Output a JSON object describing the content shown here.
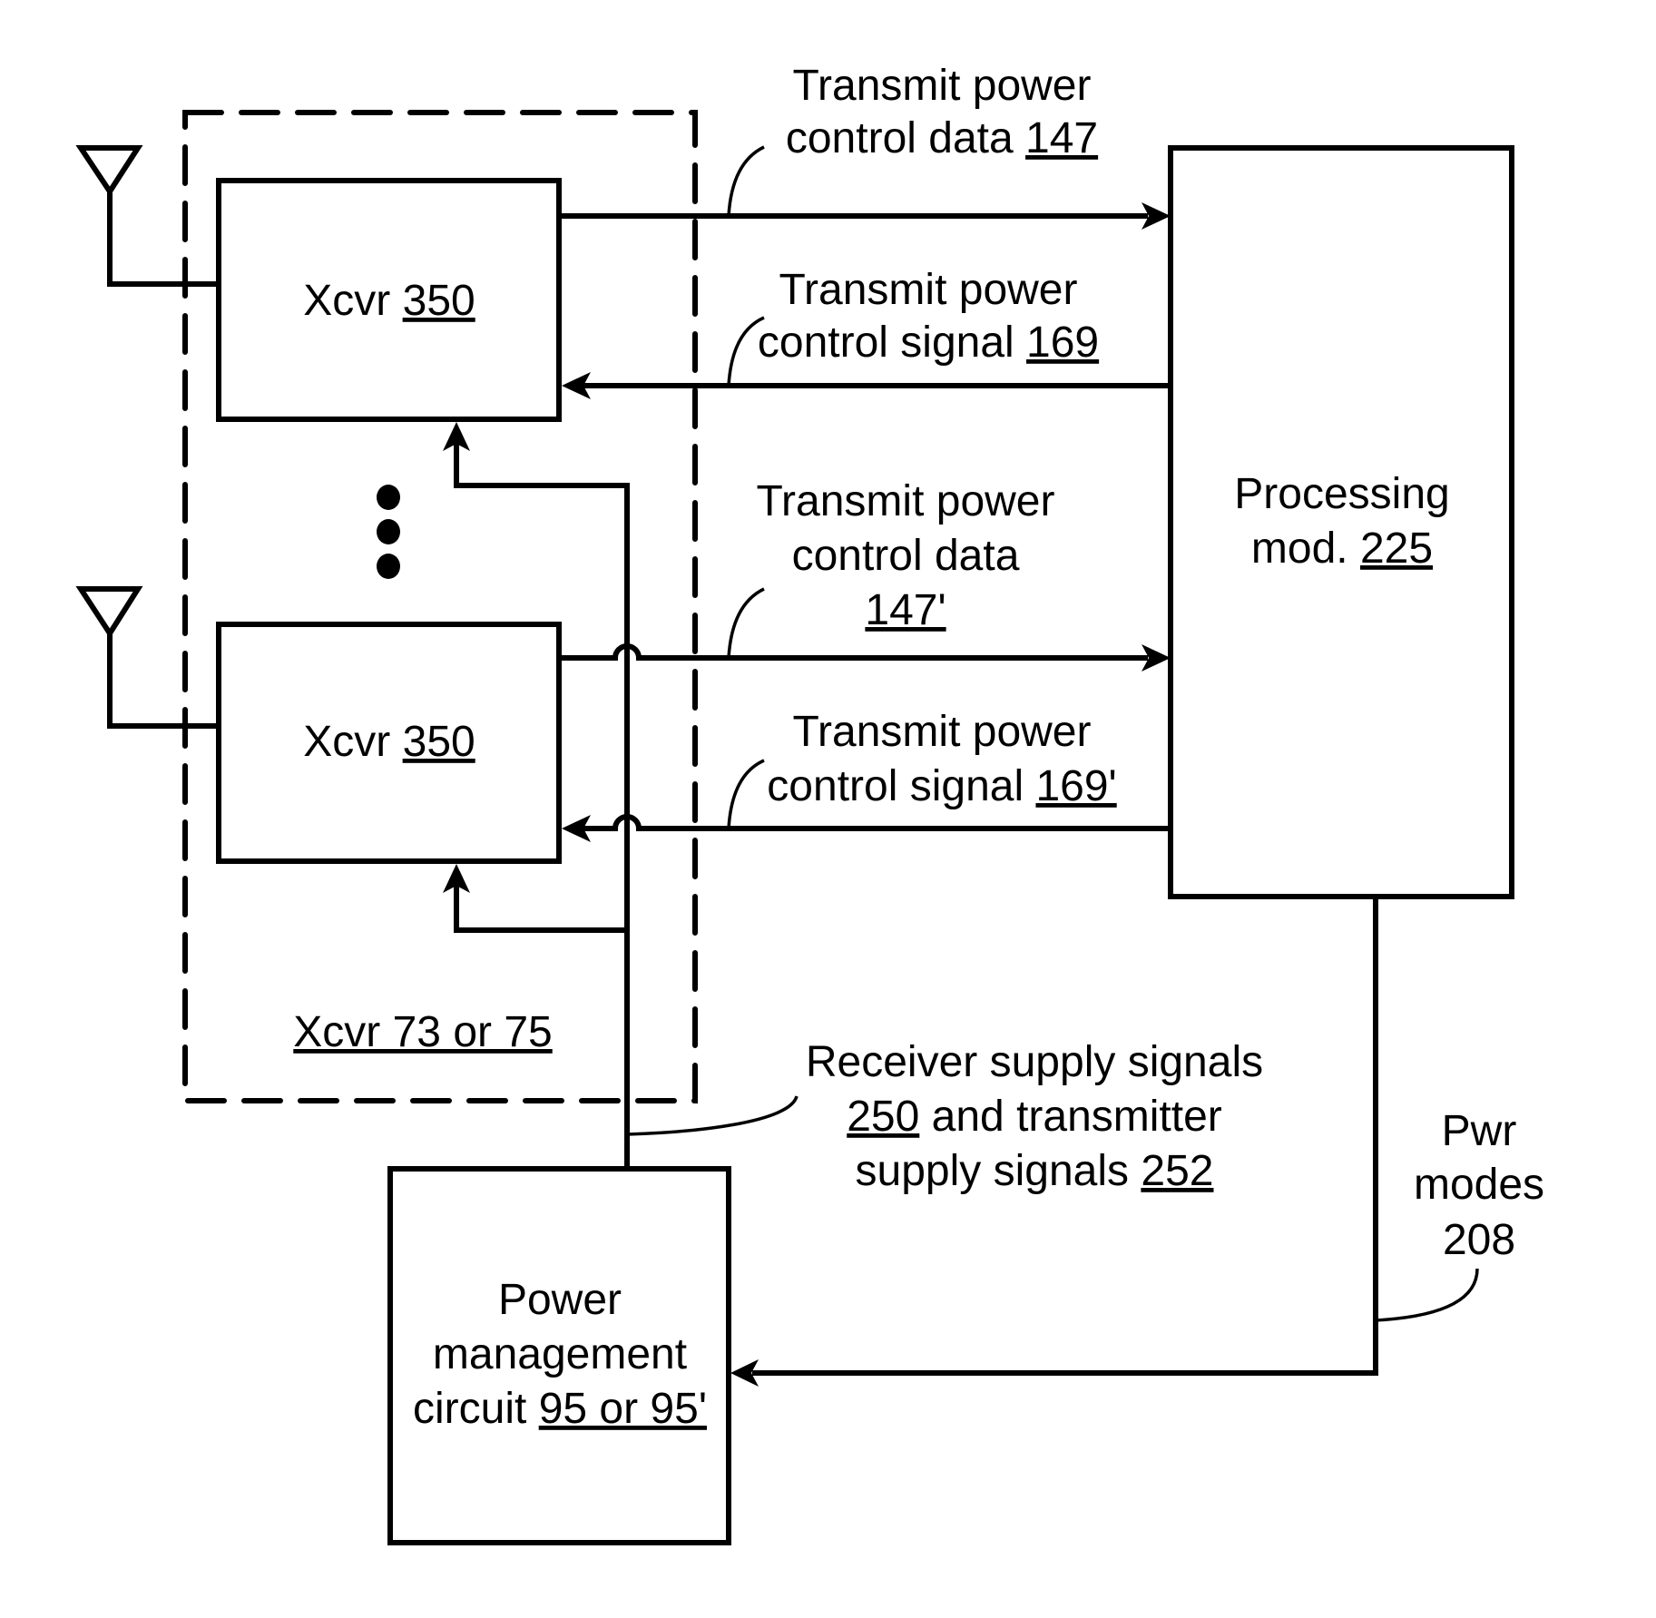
{
  "figure": {
    "container": {
      "label": "Xcvr 73 or 75"
    },
    "transceivers": [
      {
        "name": "Xcvr",
        "ref": "350"
      },
      {
        "name": "Xcvr",
        "ref": "350"
      }
    ],
    "processing_module": {
      "line1": "Processing",
      "line2_prefix": "mod. ",
      "ref": "225"
    },
    "power_management": {
      "line1": "Power",
      "line2": "management",
      "line3_prefix": "circuit ",
      "ref": "95 or 95'"
    },
    "signals": {
      "tx_power_control_data": {
        "line1": "Transmit power",
        "line2_prefix": "control data ",
        "ref": "147"
      },
      "tx_power_control_signal": {
        "line1": "Transmit power",
        "line2_prefix": "control signal ",
        "ref": "169"
      },
      "tx_power_control_data_prime": {
        "line1": "Transmit power",
        "line2": "control data",
        "ref": "147'"
      },
      "tx_power_control_signal_prime": {
        "line1": "Transmit power",
        "line2_prefix": "control signal ",
        "ref": "169'"
      },
      "supply_signals": {
        "line1": "Receiver supply signals",
        "line2_ref": "250",
        "line2_suffix": " and transmitter",
        "line3_prefix": "supply signals ",
        "line3_ref": "252"
      },
      "power_modes": {
        "line1": "Pwr",
        "line2": "modes",
        "line3": "208"
      }
    },
    "icons": [
      "antenna-icon",
      "antenna-icon",
      "ellipsis-dots-icon"
    ]
  }
}
